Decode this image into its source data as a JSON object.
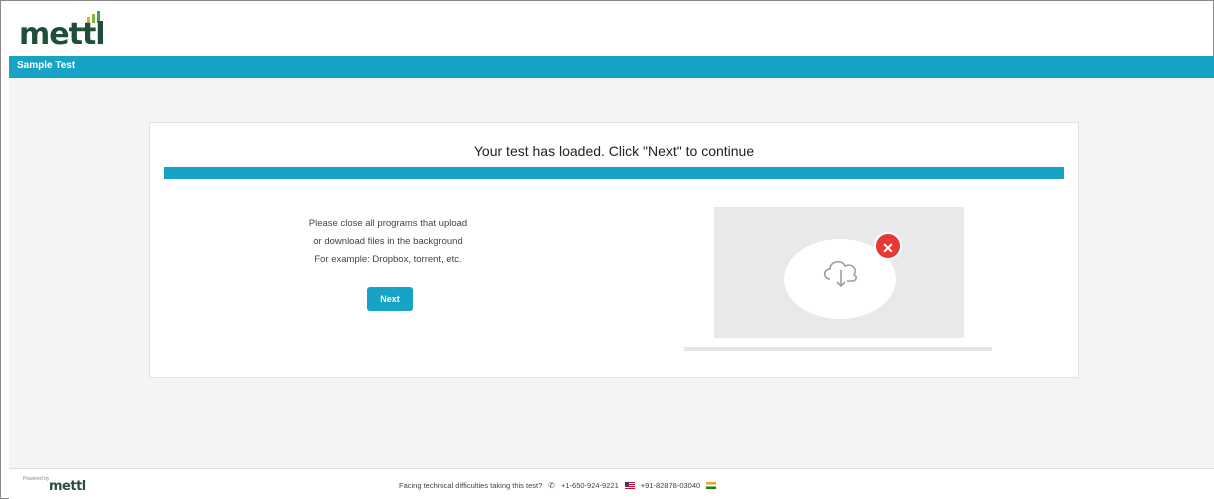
{
  "app": {
    "logo_text": "mettl",
    "section_title": "Sample Test"
  },
  "card": {
    "title": "Your test has loaded. Click \"Next\" to continue",
    "instructions": [
      "Please close all programs that upload",
      "or download files in the background",
      "For example: Dropbox, torrent, etc."
    ],
    "next_label": "Next"
  },
  "illustration": {
    "icon": "cloud-download-icon",
    "badge_icon": "close-icon",
    "badge_symbol": "✕"
  },
  "footer": {
    "powered_by": "Powered by",
    "logo_text": "mettl",
    "support_text": "Facing technical difficulties taking this test?",
    "phone_us": "+1-650-924-9221",
    "phone_in": "+91-82878-03040"
  },
  "colors": {
    "accent": "#17a3c5",
    "error": "#e53935"
  }
}
